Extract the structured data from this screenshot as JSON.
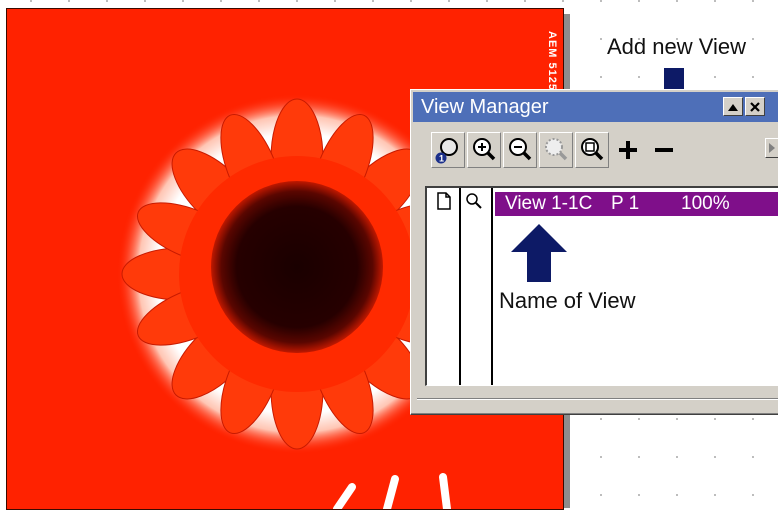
{
  "document": {
    "vertical_code": "AEM 5125"
  },
  "annotations": {
    "add_new_view": "Add new View",
    "name_of_view": "Name of View"
  },
  "view_manager": {
    "title": "View Manager",
    "toolbar": {
      "buttons": [
        {
          "icon": "view-number-magnifier-icon"
        },
        {
          "icon": "zoom-in-icon"
        },
        {
          "icon": "zoom-out-icon"
        },
        {
          "icon": "zoom-marquee-icon"
        },
        {
          "icon": "zoom-fit-icon"
        },
        {
          "icon": "add-view-icon"
        },
        {
          "icon": "remove-view-icon"
        }
      ]
    },
    "views": [
      {
        "name": "View 1-1C",
        "page": "P 1",
        "zoom": "100%"
      }
    ]
  },
  "colors": {
    "artwork_red": "#ff2200",
    "title_bar": "#4e6fb8",
    "selected_row": "#7f0f8a",
    "arrow": "#0d1a66"
  }
}
